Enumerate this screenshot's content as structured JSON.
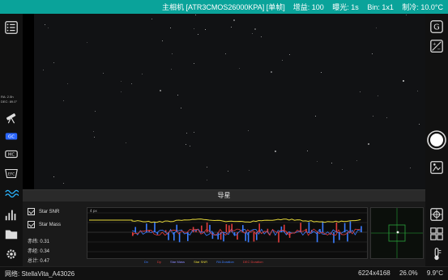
{
  "topbar": {
    "title": "主相机 [ATR3CMOS26000KPA] [单帧]",
    "gain": "增益: 100",
    "exposure": "曝光: 1s",
    "bin": "Bin: 1x1",
    "cooling": "制冷: 10.0°C"
  },
  "leftbar": {
    "radec": {
      "ra": "RA:",
      "ra_val": "2.5h",
      "dec": "DEC:",
      "dec_val": "89.0°"
    },
    "efc_label": "EFC"
  },
  "guide": {
    "title": "导星",
    "checks": [
      {
        "label": "Star SNR"
      },
      {
        "label": "Star Mass"
      }
    ],
    "rms": [
      "赤纬: 0.31",
      "赤经: 0.34",
      "总计: 0.47"
    ],
    "scale_label": "4 px",
    "legend": [
      {
        "label": "Dx",
        "color": "#3b7dff"
      },
      {
        "label": "Dy",
        "color": "#e03c3c"
      },
      {
        "label": "Star Mass",
        "color": "#8a8aff"
      },
      {
        "label": "Star SNR",
        "color": "#e6d83a"
      },
      {
        "label": "RA Duration",
        "color": "#3b7dff"
      },
      {
        "label": "DEC Duration",
        "color": "#e03c3c"
      }
    ]
  },
  "bottombar": {
    "network": "网络: StellaVita_A43026",
    "resolution": "6224x4168",
    "percent": "26.0%",
    "temperature": "9.9°C"
  },
  "colors": {
    "accent": "#0aa39a"
  }
}
